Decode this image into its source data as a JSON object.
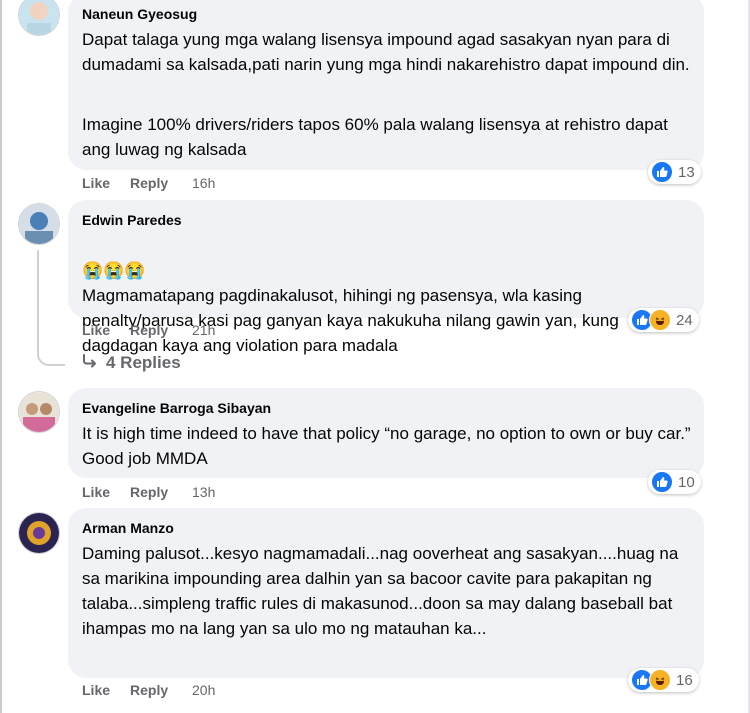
{
  "comments": [
    {
      "author": "Naneun Gyeosug",
      "text": "Dapat talaga yung mga walang lisensya impound agad sasakyan nyan para di dumadami sa kalsada,pati narin yung mga hindi nakarehistro dapat impound din.",
      "text2": "Imagine 100% drivers/riders tapos 60% pala walang lisensya at rehistro dapat ang luwag ng kalsada",
      "like_label": "Like",
      "reply_label": "Reply",
      "time": "16h",
      "reaction_count": "13",
      "reactions": [
        "like-icon"
      ]
    },
    {
      "author": "Edwin Paredes",
      "emoji": "😭😭😭",
      "text": "Magmamatapang pagdinakalusot, hihingi ng pasensya, wla kasing penalty/parusa kasi pag ganyan kaya nakukuha nilang gawin yan, kung dagdagan kaya ang violation para madala",
      "like_label": "Like",
      "reply_label": "Reply",
      "time": "21h",
      "reaction_count": "24",
      "reactions": [
        "like-icon",
        "haha-icon"
      ]
    },
    {
      "author": "Evangeline Barroga Sibayan",
      "text": "It is high time indeed to have that policy “no garage, no option to own or buy car.” Good job MMDA",
      "like_label": "Like",
      "reply_label": "Reply",
      "time": "13h",
      "reaction_count": "10",
      "reactions": [
        "like-icon"
      ]
    },
    {
      "author": "Arman Manzo",
      "text": "Daming palusot...kesyo nagmamadali...nag ooverheat ang sasakyan....huag na sa marikina impounding area dalhin yan sa bacoor cavite para pakapitan ng talaba...simpleng traffic rules di makasunod...doon sa may dalang baseball bat ihampas mo na lang yan sa ulo mo ng matauhan ka...",
      "like_label": "Like",
      "reply_label": "Reply",
      "time": "20h",
      "reaction_count": "16",
      "reactions": [
        "like-icon",
        "haha-icon"
      ]
    }
  ],
  "replies_link": "4 Replies",
  "colors": {
    "bubble": "#f0f2f5",
    "like_blue": "#1877f2",
    "haha_yellow": "#f7b125",
    "meta_gray": "#65676b"
  }
}
